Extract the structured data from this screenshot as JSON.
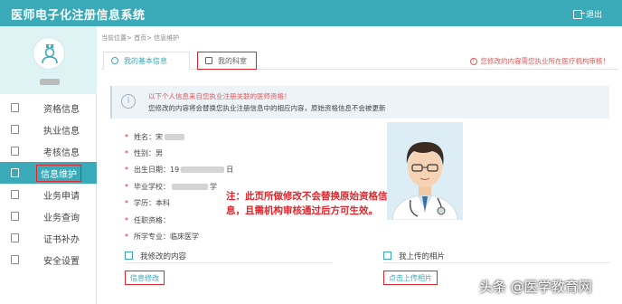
{
  "header": {
    "title": "医师电子化注册信息系统",
    "logout_label": "退出"
  },
  "sidebar": {
    "items": [
      {
        "label": "资格信息",
        "icon": "doc-icon"
      },
      {
        "label": "执业信息",
        "icon": "headset-icon"
      },
      {
        "label": "考核信息",
        "icon": "clipboard-icon"
      },
      {
        "label": "信息维护",
        "icon": "id-card-icon"
      },
      {
        "label": "业务申请",
        "icon": "form-icon"
      },
      {
        "label": "业务查询",
        "icon": "search-doc-icon"
      },
      {
        "label": "证书补办",
        "icon": "certificate-icon"
      },
      {
        "label": "安全设置",
        "icon": "user-lock-icon"
      }
    ]
  },
  "breadcrumb": "当前位置> 首页> 信息维护",
  "tabs": {
    "basic": "我的基本信息",
    "division": "我的科室",
    "warning": "您修改的内容需您执业所在医疗机构审核！"
  },
  "notice": {
    "line1": "以下个人信息来自您执业注册关联的医师资格！",
    "line2": "您修改的内容将会替换您执业注册信息中的相应内容，原始资格信息不会被更新"
  },
  "profile": {
    "name_label": "姓名：宋",
    "gender_label": "性别：男",
    "birth_prefix": "出生日期：19",
    "birth_suffix": "日",
    "school_label": "毕业学校：",
    "school_suffix": "学",
    "education_label": "学历：本科",
    "title_label": "任职资格：",
    "major_label": "所学专业：临床医学"
  },
  "annotation": "注：此页所做修改不会替换原始资格信息，且需机构审核通过后方可生效。",
  "sections": {
    "changes_title": "我修改的内容",
    "changes_button": "信息修改",
    "photos_title": "我上传的相片",
    "photos_button": "点击上传相片"
  },
  "watermark": "头条 @医学教育网",
  "colors": {
    "accent": "#3aa9b8",
    "highlight": "#e0262c"
  }
}
